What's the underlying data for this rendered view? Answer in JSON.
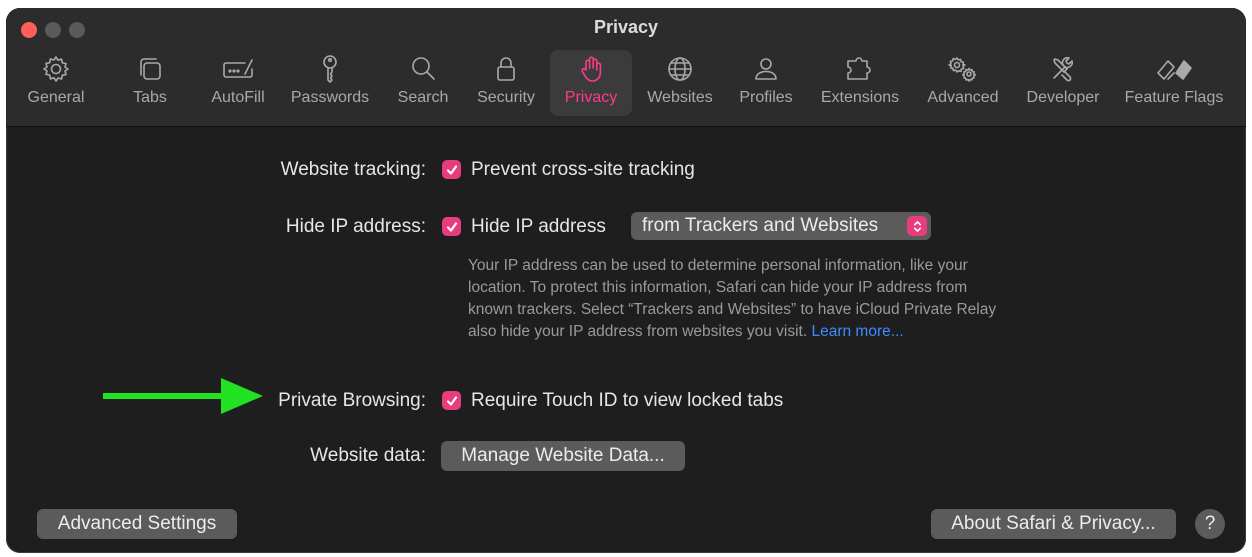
{
  "window": {
    "title": "Privacy"
  },
  "toolbar": {
    "items": [
      {
        "label": "General",
        "icon": "gear-icon"
      },
      {
        "label": "Tabs",
        "icon": "tabs-icon"
      },
      {
        "label": "AutoFill",
        "icon": "autofill-icon"
      },
      {
        "label": "Passwords",
        "icon": "key-icon"
      },
      {
        "label": "Search",
        "icon": "search-icon"
      },
      {
        "label": "Security",
        "icon": "lock-icon"
      },
      {
        "label": "Privacy",
        "icon": "hand-icon",
        "active": true
      },
      {
        "label": "Websites",
        "icon": "globe-icon"
      },
      {
        "label": "Profiles",
        "icon": "person-icon"
      },
      {
        "label": "Extensions",
        "icon": "puzzle-icon"
      },
      {
        "label": "Advanced",
        "icon": "gears-icon"
      },
      {
        "label": "Developer",
        "icon": "tools-icon"
      },
      {
        "label": "Feature Flags",
        "icon": "flags-icon"
      }
    ]
  },
  "settings": {
    "tracking": {
      "label": "Website tracking:",
      "checkbox_text": "Prevent cross-site tracking",
      "checked": true
    },
    "hide_ip": {
      "label": "Hide IP address:",
      "checkbox_text": "Hide IP address",
      "checked": true,
      "popup_value": "from Trackers and Websites",
      "description": "Your IP address can be used to determine personal information, like your location. To protect this information, Safari can hide your IP address from known trackers. Select “Trackers and Websites” to have iCloud Private Relay also hide your IP address from websites you visit.",
      "learn_more": "Learn more..."
    },
    "private_browsing": {
      "label": "Private Browsing:",
      "checkbox_text": "Require Touch ID to view locked tabs",
      "checked": true
    },
    "website_data": {
      "label": "Website data:",
      "button": "Manage Website Data..."
    }
  },
  "footer": {
    "advanced_button": "Advanced Settings",
    "about_button": "About Safari & Privacy...",
    "help_button": "?"
  },
  "colors": {
    "accent": "#e73c7e",
    "active_tab": "#ff3a8c",
    "link": "#3d8bff",
    "arrow": "#22e022"
  }
}
